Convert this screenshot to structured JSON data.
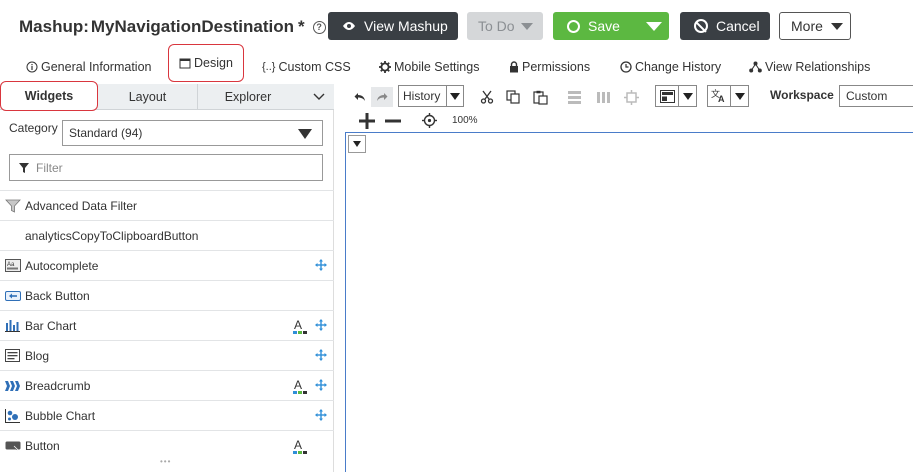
{
  "header": {
    "title_prefix": "Mashup:",
    "title_name": "MyNavigationDestination",
    "unsaved_marker": "*",
    "help_icon": "question-circle-icon",
    "view_mashup_label": "View Mashup",
    "todo_label": "To Do",
    "save_label": "Save",
    "cancel_label": "Cancel",
    "more_label": "More",
    "colors": {
      "dark_button": "#3a3f44",
      "save_green": "#5cb841",
      "disabled": "#d5d7d9",
      "highlight_red": "#d9363e"
    }
  },
  "tabs": [
    {
      "label": "General Information",
      "icon": "info-circle-icon"
    },
    {
      "label": "Design",
      "icon": "window-icon",
      "active": true
    },
    {
      "label": "Custom CSS",
      "icon": "braces-icon"
    },
    {
      "label": "Mobile Settings",
      "icon": "gear-icon"
    },
    {
      "label": "Permissions",
      "icon": "lock-icon"
    },
    {
      "label": "Change History",
      "icon": "clock-icon"
    },
    {
      "label": "View Relationships",
      "icon": "hierarchy-icon"
    }
  ],
  "left_panel": {
    "tabs": {
      "widgets": "Widgets",
      "layout": "Layout",
      "explorer": "Explorer"
    },
    "category_label": "Category",
    "category_value": "Standard (94)",
    "filter_placeholder": "Filter",
    "widgets": [
      {
        "label": "Advanced Data Filter",
        "icon": "funnel-icon",
        "style": false,
        "move": false
      },
      {
        "label": "analyticsCopyToClipboardButton",
        "icon": "",
        "style": false,
        "move": false
      },
      {
        "label": "Autocomplete",
        "icon": "autocomplete-icon",
        "style": false,
        "move": true
      },
      {
        "label": "Back Button",
        "icon": "back-button-icon",
        "style": false,
        "move": false
      },
      {
        "label": "Bar Chart",
        "icon": "bar-chart-icon",
        "style": true,
        "move": true
      },
      {
        "label": "Blog",
        "icon": "blog-icon",
        "style": false,
        "move": true
      },
      {
        "label": "Breadcrumb",
        "icon": "breadcrumb-icon",
        "style": true,
        "move": true
      },
      {
        "label": "Bubble Chart",
        "icon": "bubble-chart-icon",
        "style": false,
        "move": true
      },
      {
        "label": "Button",
        "icon": "button-icon",
        "style": true,
        "move": false
      }
    ]
  },
  "toolbar": {
    "history_label": "History",
    "workspace_label": "Workspace",
    "workspace_value": "Custom",
    "zoom_level": "100%"
  }
}
